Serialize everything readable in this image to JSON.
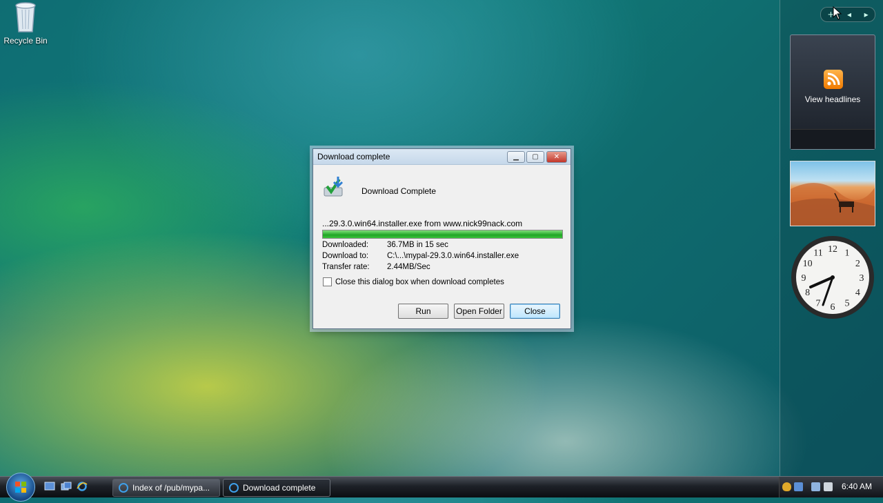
{
  "desktop": {
    "recycle_bin_label": "Recycle Bin"
  },
  "sidebar": {
    "feed_gadget_label": "View headlines",
    "clock_numbers": [
      "12",
      "1",
      "2",
      "3",
      "4",
      "5",
      "6",
      "7",
      "8",
      "9",
      "10",
      "11"
    ]
  },
  "dialog": {
    "title": "Download complete",
    "heading": "Download Complete",
    "file_line": "...29.3.0.win64.installer.exe from www.nick99nack.com",
    "progress_fraction": 1.0,
    "downloaded_label": "Downloaded:",
    "downloaded_value": "36.7MB in 15 sec",
    "download_to_label": "Download to:",
    "download_to_value": "C:\\...\\mypal-29.3.0.win64.installer.exe",
    "transfer_rate_label": "Transfer rate:",
    "transfer_rate_value": "2.44MB/Sec",
    "close_checkbox_label": "Close this dialog box when download completes",
    "run_label": "Run",
    "open_folder_label": "Open Folder",
    "close_label": "Close"
  },
  "taskbar": {
    "tasks": [
      {
        "label": "Index of /pub/mypa..."
      },
      {
        "label": "Download complete"
      }
    ],
    "time": "6:40 AM"
  },
  "colors": {
    "progress_green": "#1fa525",
    "rss_orange": "#f07a00"
  }
}
